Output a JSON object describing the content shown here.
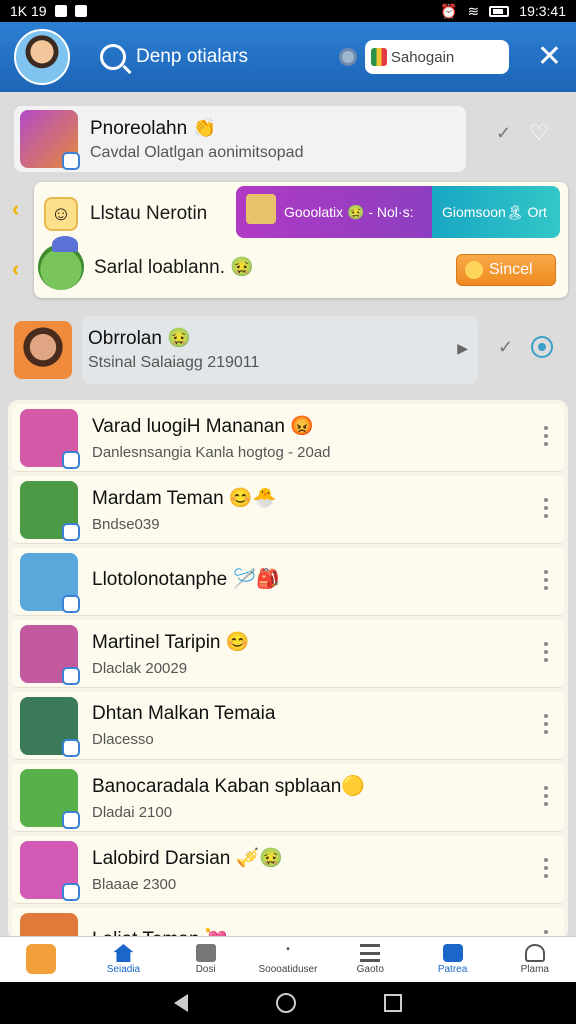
{
  "status": {
    "left": "1K 19",
    "time": "19:3:41"
  },
  "header": {
    "search_text": "Denp otialars",
    "search_placeholder": "Sahogain"
  },
  "pinned_top": {
    "name": "Pnoreolahn 👏",
    "preview": "Cavdal Olatlgan aonimitsopad"
  },
  "popup": {
    "title": "Llstau Nerotin",
    "purple_label": "Gooolatix 🤢 - Nol·s:",
    "teal_label": "Giomsoon🏝 Ort",
    "subtitle": "Sarlal loablann. 🤢",
    "send_label": "Sincel"
  },
  "pinned_second": {
    "name": "Obrrolan 🤢",
    "preview": "Stsinal Salaiagg 219011"
  },
  "chats": [
    {
      "name": "Varad luogiH Mananan 😡",
      "preview": "Danlesnsangia Kanla hogtog - 20ad",
      "avatar_color": "#d45aa8"
    },
    {
      "name": "Mardam Teman 😊🐣",
      "preview": "Bndse039",
      "avatar_color": "#4c9a46"
    },
    {
      "name": "Llotolonotanphe 🪡🎒",
      "preview": "",
      "avatar_color": "#5aa7dc"
    },
    {
      "name": "Martinel Taripin 😊",
      "preview": "Dlaclak 20029",
      "avatar_color": "#c35aa0"
    },
    {
      "name": "Dhtan Malkan Temaia",
      "preview": "Dlacesso",
      "avatar_color": "#3a7a5a"
    },
    {
      "name": "Banocaradala Kaban spblaan🟡",
      "preview": "Dladai 2100",
      "avatar_color": "#58b04a"
    },
    {
      "name": "Lalobird Darsian 🎺🤢",
      "preview": "Blaaae 2300",
      "avatar_color": "#d25ab4"
    },
    {
      "name": "Laliat Teman 💘",
      "preview": "",
      "avatar_color": "#e07a3a"
    }
  ],
  "tabs": [
    {
      "label": "",
      "icon": "cat-icon"
    },
    {
      "label": "Seiadia",
      "icon": "home-icon",
      "active": true
    },
    {
      "label": "Dosi",
      "icon": "book-icon"
    },
    {
      "label": "Soooatiduser",
      "icon": "dots-icon"
    },
    {
      "label": "Gaoto",
      "icon": "menu-icon"
    },
    {
      "label": "Patrea",
      "icon": "chat-icon",
      "active": true
    },
    {
      "label": "Plama",
      "icon": "person-icon"
    }
  ]
}
